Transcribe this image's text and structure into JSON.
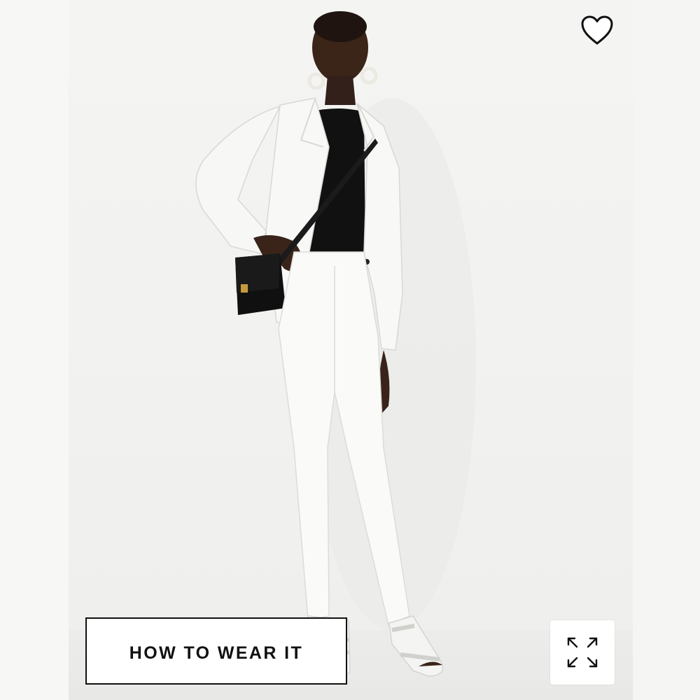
{
  "product_image": {
    "alt_subject": "model-white-suit",
    "background_color": "#f3f3f1"
  },
  "favorite": {
    "icon": "heart-outline-icon",
    "color": "#111111"
  },
  "how_to_wear": {
    "label": "HOW TO WEAR IT"
  },
  "expand": {
    "icon": "expand-arrows-icon",
    "color": "#111111"
  }
}
